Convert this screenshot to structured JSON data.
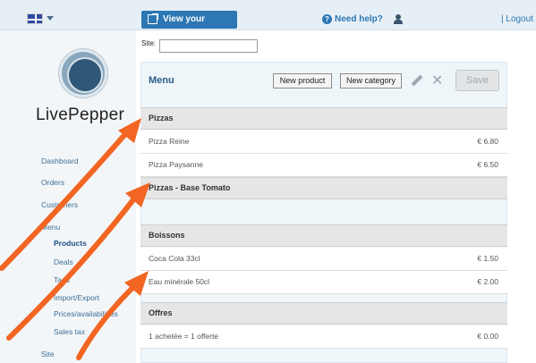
{
  "topbar": {
    "view_site_label": "View your website",
    "help_label": "Need help?",
    "logout_label": "| Logout"
  },
  "sidebar": {
    "brand": "LivePepper",
    "items": [
      {
        "label": "Dashboard"
      },
      {
        "label": "Orders"
      },
      {
        "label": "Customers"
      },
      {
        "label": "Menu"
      },
      {
        "label": "Products",
        "active": true
      },
      {
        "label": "Deals"
      },
      {
        "label": "Tags"
      },
      {
        "label": "Import/Export"
      },
      {
        "label": "Prices/availabilities"
      },
      {
        "label": "Sales tax"
      },
      {
        "label": "Site"
      }
    ]
  },
  "site": {
    "label": "Site:"
  },
  "main": {
    "title": "Menu",
    "new_product_label": "New product",
    "new_category_label": "New category",
    "save_label": "Save",
    "categories": [
      {
        "name": "Pizzas",
        "items": [
          {
            "name": "Pizza Reine",
            "price": "€ 6.80"
          },
          {
            "name": "Pizza Paysanne",
            "price": "€ 6.50"
          }
        ]
      },
      {
        "name": "Pizzas -  Base Tomato",
        "items": []
      },
      {
        "name": "Boissons",
        "items": [
          {
            "name": "Coca Cola 33cl",
            "price": "€ 1.50"
          },
          {
            "name": "Eau minérale 50cl",
            "price": "€ 2.00"
          }
        ]
      },
      {
        "name": "Offres",
        "items": [
          {
            "name": "1 achetée = 1 offerte",
            "price": "€ 0.00"
          }
        ]
      }
    ]
  },
  "colors": {
    "accent": "#2c77b4",
    "arrow": "#f26522"
  }
}
